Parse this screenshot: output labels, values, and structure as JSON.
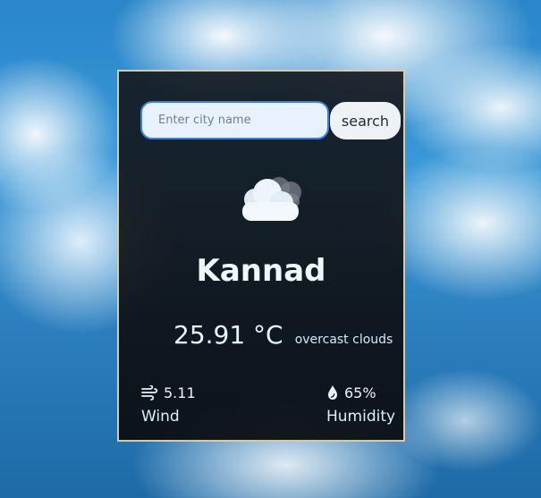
{
  "search": {
    "placeholder": "Enter city name",
    "button_label": "search"
  },
  "weather": {
    "city": "Kannad",
    "temperature": "25.91 °C",
    "description": "overcast clouds",
    "icon": "cloud-icon"
  },
  "stats": {
    "wind": {
      "value": "5.11",
      "label": "Wind",
      "icon": "wind-icon"
    },
    "humidity": {
      "value": "65%",
      "label": "Humidity",
      "icon": "water-drop-icon"
    }
  }
}
